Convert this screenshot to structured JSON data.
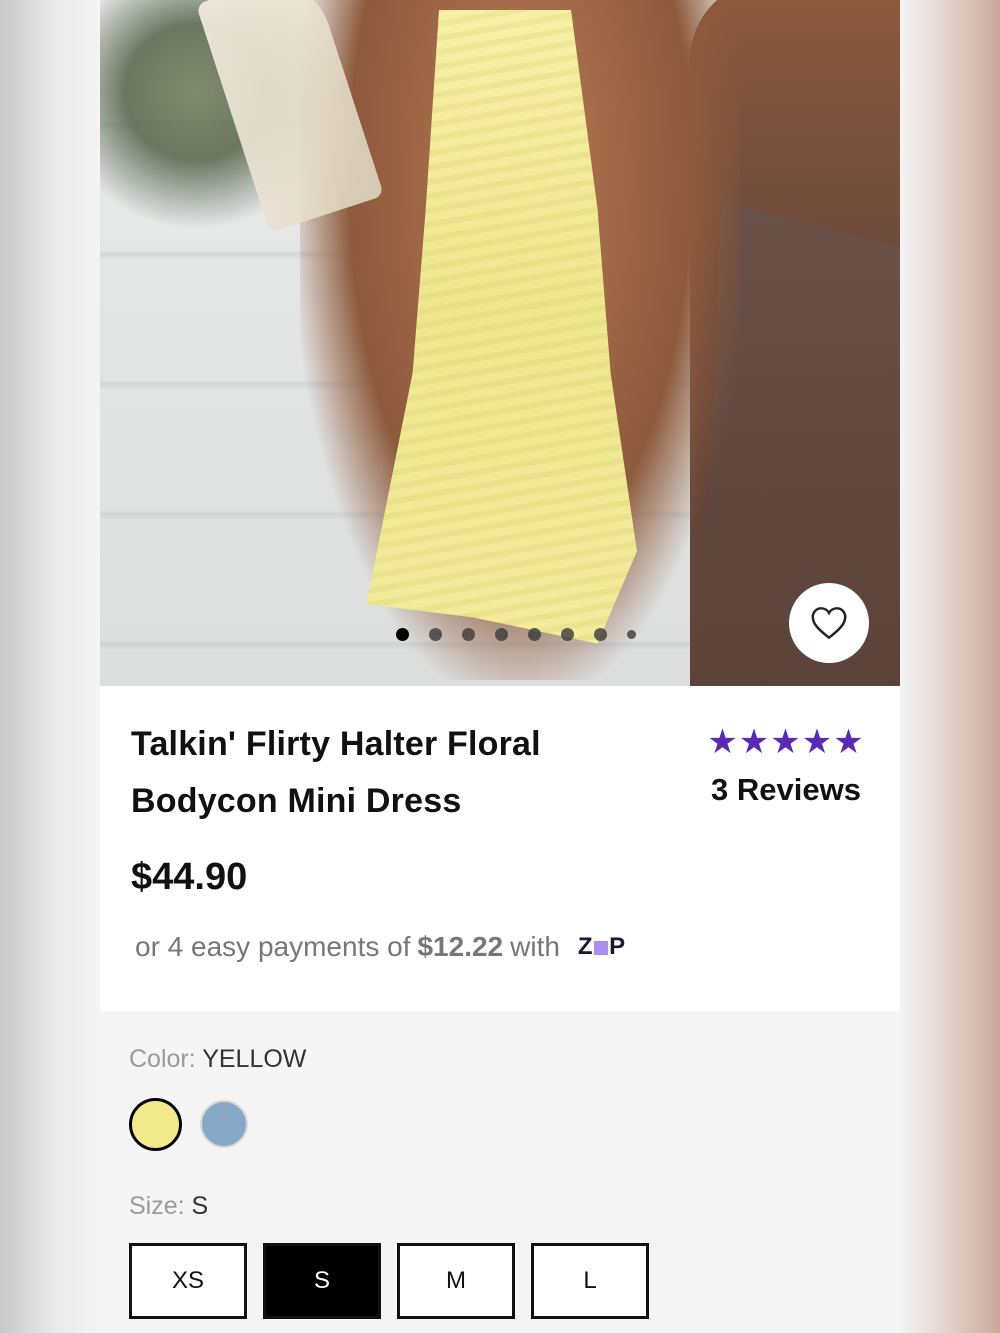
{
  "product": {
    "title": "Talkin' Flirty Halter Floral Bodycon Mini Dress",
    "rating_stars": "★★★★★",
    "reviews_label": "3 Reviews",
    "price": "$44.90"
  },
  "installments": {
    "prefix": "or 4 easy payments of",
    "amount": "$12.22",
    "suffix": "with",
    "provider_logo": "zip"
  },
  "carousel": {
    "image_count": 8,
    "active_index": 0
  },
  "color": {
    "label": "Color:",
    "selected": "YELLOW",
    "swatches": [
      {
        "name": "yellow",
        "hex": "#f0ea8c",
        "selected": true
      },
      {
        "name": "blue",
        "hex": "#88a8c8",
        "selected": false
      }
    ]
  },
  "size": {
    "label": "Size:",
    "selected": "S",
    "options": [
      "XS",
      "S",
      "M",
      "L"
    ]
  },
  "colors": {
    "accent_star": "#5b2ab3",
    "text": "#111111"
  }
}
